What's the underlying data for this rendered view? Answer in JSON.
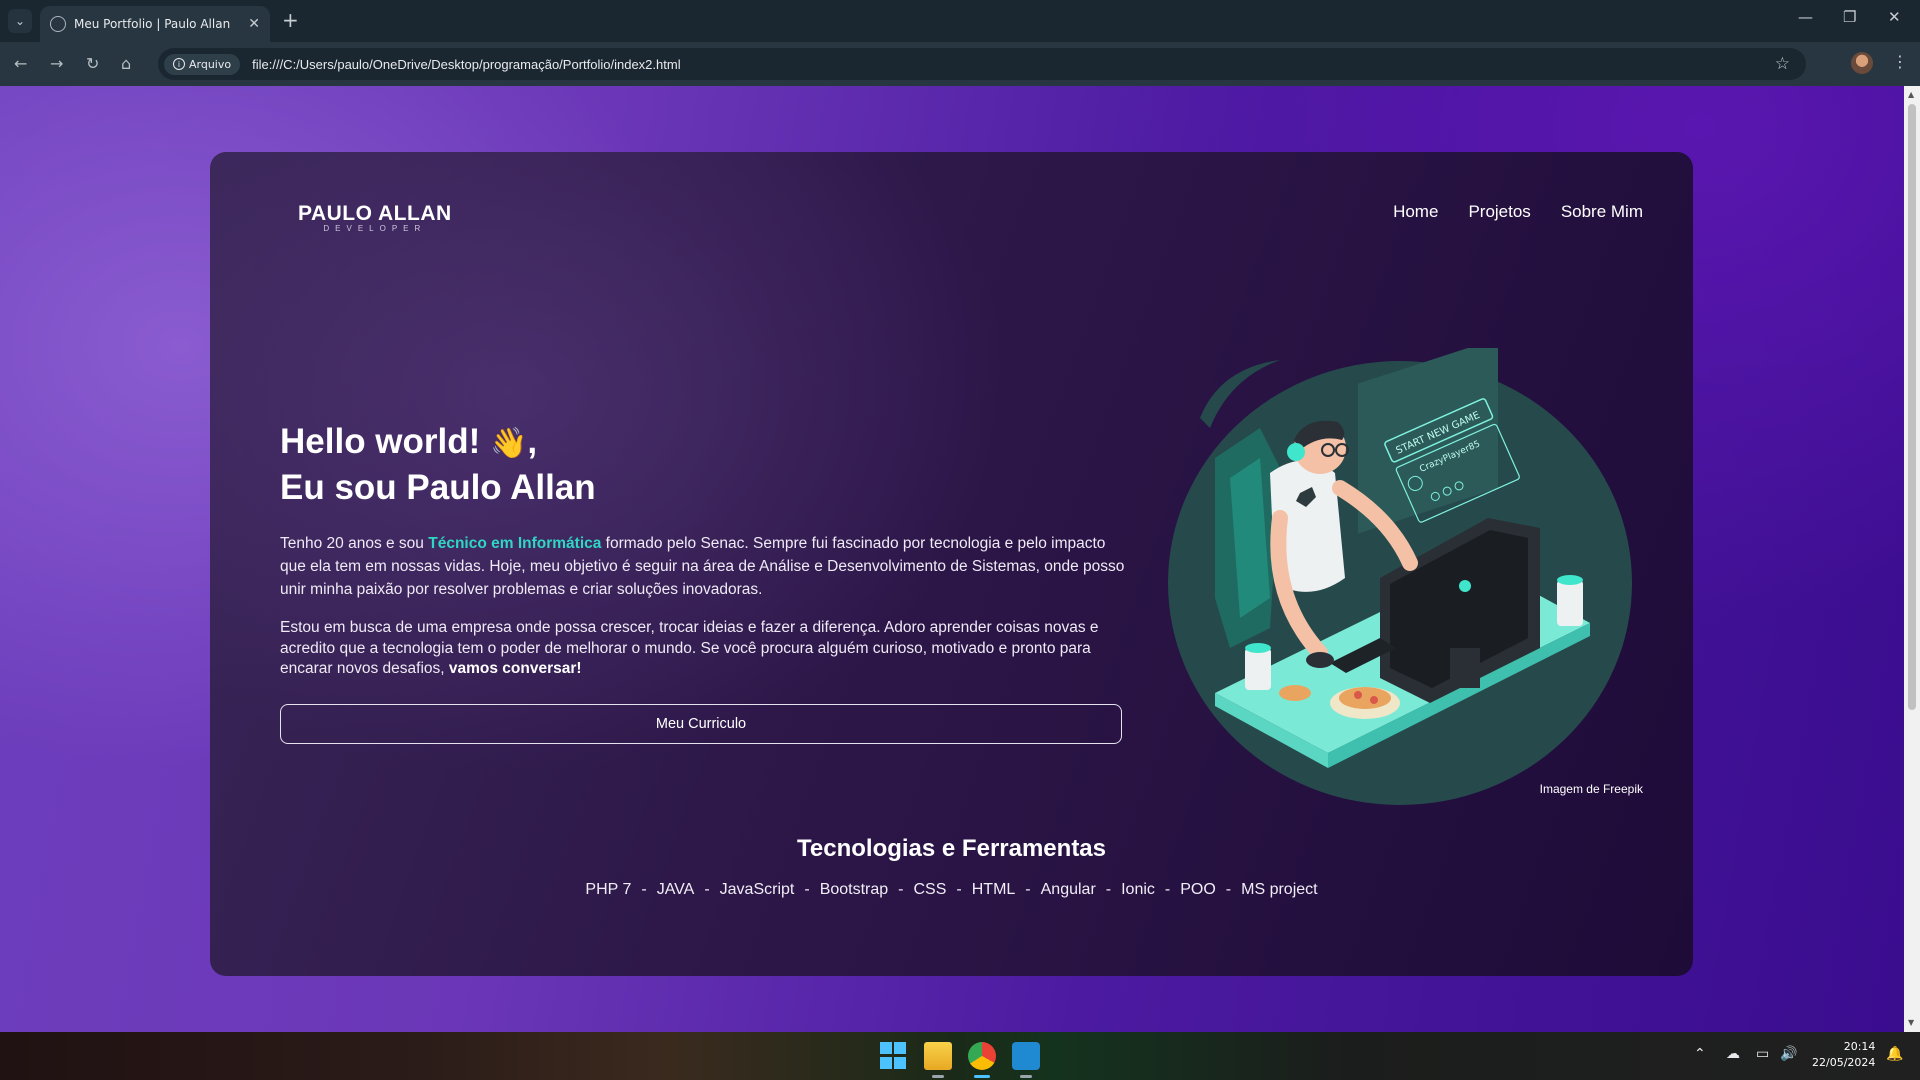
{
  "browser": {
    "tab_title": "Meu Portfolio | Paulo Allan",
    "site_info_chip": "Arquivo",
    "url": "file:///C:/Users/paulo/OneDrive/Desktop/programação/Portfolio/index2.html"
  },
  "page": {
    "logo": {
      "main": "PAULO ALLAN",
      "sub": "DEVELOPER"
    },
    "nav": [
      "Home",
      "Projetos",
      "Sobre Mim"
    ],
    "hero": {
      "line1": "Hello world!",
      "wave": "👋",
      "comma": ",",
      "line2": "Eu sou Paulo Allan"
    },
    "para1": {
      "before": "Tenho 20 anos e sou ",
      "highlight": "Técnico em Informática",
      "after": " formado pelo Senac. Sempre fui fascinado por tecnologia e pelo impacto que ela tem em nossas vidas. Hoje, meu objetivo é seguir na área de Análise e Desenvolvimento de Sistemas, onde posso unir minha paixão por resolver problemas e criar soluções inovadoras."
    },
    "para2": {
      "text": "Estou em busca de uma empresa onde possa crescer, trocar ideias e fazer a diferença. Adoro aprender coisas novas e acredito que a tecnologia tem o poder de melhorar o mundo. Se você procura alguém curioso, motivado e pronto para encarar novos desafios, ",
      "bold": "vamos conversar!"
    },
    "cv_button": "Meu Curriculo",
    "illustration": {
      "screen_text": "START NEW GAME",
      "player_name": "CrazyPlayer85"
    },
    "image_credit": "Imagem de Freepik",
    "tech_title": "Tecnologias e Ferramentas",
    "tech_separator": "-",
    "technologies": [
      "PHP 7",
      "JAVA",
      "JavaScript",
      "Bootstrap",
      "CSS",
      "HTML",
      "Angular",
      "Ionic",
      "POO",
      "MS project"
    ]
  },
  "taskbar": {
    "time": "20:14",
    "date": "22/05/2024"
  }
}
